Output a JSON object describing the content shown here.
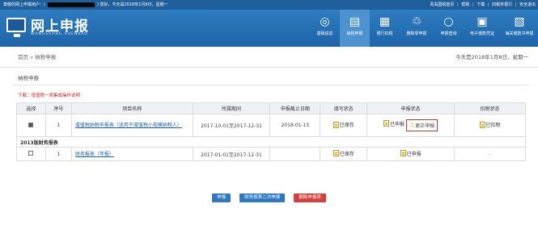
{
  "topbar": {
    "greet_prefix": "尊敬的网上申报用户：(",
    "greet_suffix": ") 您好，今天是2018年1月8日，星期一",
    "links": [
      "青岛国税首页",
      "帮助",
      "下载",
      "旧税务报行",
      "安全退出"
    ]
  },
  "header": {
    "title": "网上申报",
    "subtitle": "WANGSHANG  SHENBAO",
    "nav": [
      {
        "label": "基础信息",
        "icon": "person-circle-icon",
        "glyph": "◎"
      },
      {
        "label": "纳税申报",
        "icon": "clipboard-icon",
        "glyph": "▤"
      },
      {
        "label": "银行扣税",
        "icon": "grid-icon",
        "glyph": "▦"
      },
      {
        "label": "删除零申报",
        "icon": "trash-icon",
        "glyph": "♲"
      },
      {
        "label": "申报查询",
        "icon": "search-icon",
        "glyph": "○"
      },
      {
        "label": "电子缴款凭证",
        "icon": "document-icon",
        "glyph": "▣"
      },
      {
        "label": "海关缴款书申报",
        "icon": "receipt-icon",
        "glyph": "▧"
      }
    ]
  },
  "breadcrumb": {
    "path": "首页 » 纳税申报",
    "date": "今天是2018年1月8日，星期一"
  },
  "section": {
    "title": "纳税申报",
    "download": "下载：增值税一类集成操作说明"
  },
  "table": {
    "headers": [
      "选择",
      "序号",
      "项目名称",
      "所属期间",
      "申报截止日期",
      "填写状态",
      "申报状态",
      "扣税状态"
    ],
    "row1": {
      "seq": "1",
      "name": "增值税纳税申报表（适用于增值税小规模纳税人）",
      "period": "2017-10-01至2017-12-31",
      "deadline": "2018-01-15",
      "fill_status": "已保存",
      "declare_status": "已申报",
      "correct_label": "更正申报",
      "tax_status": "已扣税"
    },
    "group": "2013版财务报表",
    "row2": {
      "seq": "1",
      "name": "财务报表（年报）",
      "period": "2017-01-01至2017-12-31",
      "deadline": "",
      "fill_status": "已保存",
      "declare_status": "已申报",
      "tax_status": "--"
    }
  },
  "buttons": {
    "declare": "申报",
    "financial_second": "财务报表二次申报",
    "delete": "删除申报表"
  },
  "colors": {
    "brand": "#1f5f9b",
    "nav_active": "#4d93d1",
    "button_blue": "#2f79c4",
    "button_red": "#d6403a",
    "alert_red": "#d32020"
  }
}
